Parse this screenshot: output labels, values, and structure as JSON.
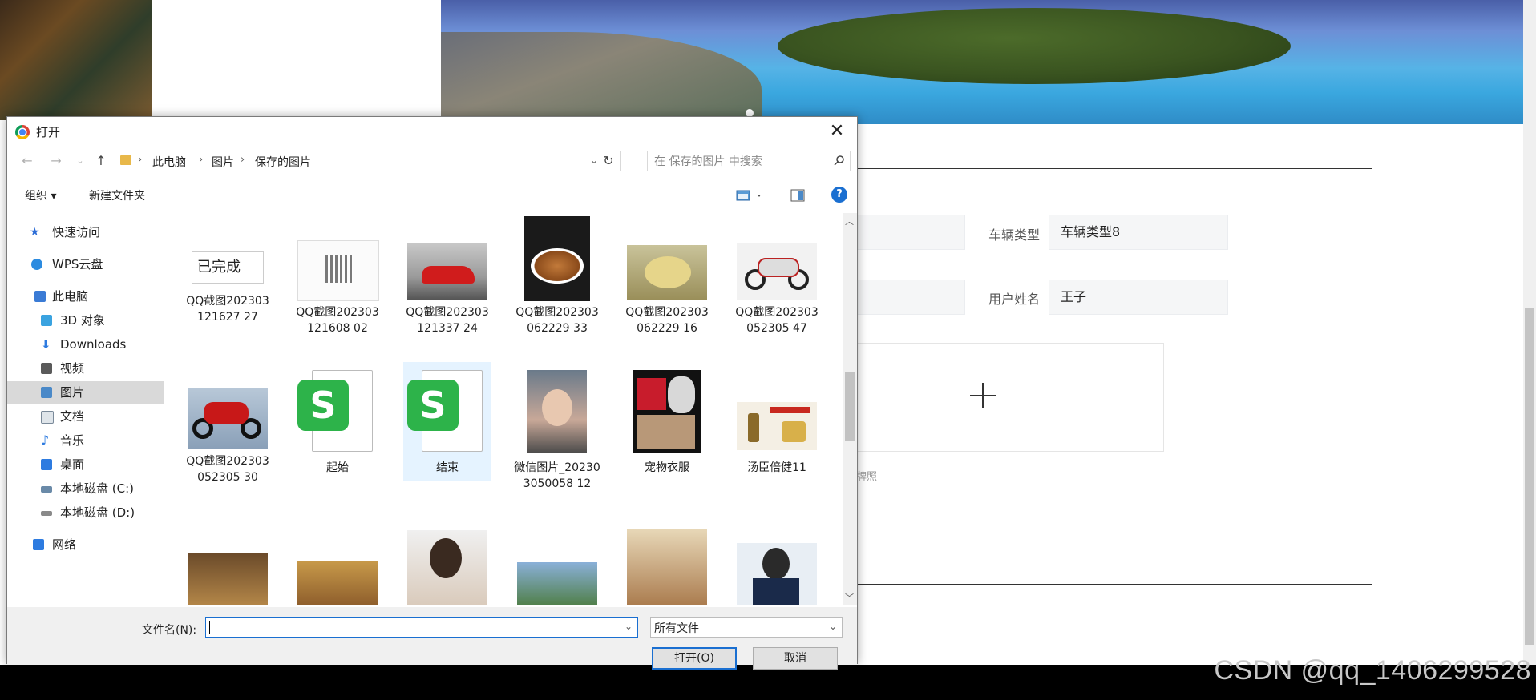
{
  "background": {
    "form": {
      "vehicle_type_label": "车辆类型",
      "vehicle_type_value": "车辆类型8",
      "user_name_label": "用户姓名",
      "user_name_value": "王子",
      "hint": "牌照"
    },
    "watermark": "CSDN @qq_1406299528"
  },
  "dialog": {
    "title": "打开",
    "close_glyph": "✕",
    "path": [
      "此电脑",
      "图片",
      "保存的图片"
    ],
    "search_placeholder": "在 保存的图片 中搜索",
    "toolbar": {
      "organize": "组织 ▾",
      "new_folder": "新建文件夹",
      "help": "?"
    },
    "nav_items": [
      {
        "label": "快速访问",
        "icon": "star-icon",
        "color": "#2b6cd6"
      },
      {
        "label": "WPS云盘",
        "icon": "cloud-icon",
        "color": "#2b8be0"
      },
      {
        "label": "此电脑",
        "icon": "computer-icon",
        "color": "#3a7bd5"
      },
      {
        "label": "3D 对象",
        "icon": "cube-icon",
        "color": "#3aa3e0"
      },
      {
        "label": "Downloads",
        "icon": "download-icon",
        "color": "#2d7be0"
      },
      {
        "label": "视频",
        "icon": "video-icon",
        "color": "#5a5a5a"
      },
      {
        "label": "图片",
        "icon": "picture-icon",
        "color": "#4a89c8"
      },
      {
        "label": "文档",
        "icon": "document-icon",
        "color": "#7a8a9a"
      },
      {
        "label": "音乐",
        "icon": "music-icon",
        "color": "#2d7be0"
      },
      {
        "label": "桌面",
        "icon": "desktop-icon",
        "color": "#2d7be0"
      },
      {
        "label": "本地磁盘 (C:)",
        "icon": "drive-c-icon",
        "color": "#6a8aa8"
      },
      {
        "label": "本地磁盘 (D:)",
        "icon": "drive-d-icon",
        "color": "#8a8a8a"
      },
      {
        "label": "网络",
        "icon": "network-icon",
        "color": "#2d7be0"
      }
    ],
    "files": [
      {
        "name": "QQ截图202303121627 27",
        "thumb_text": "已完成",
        "kind": "text"
      },
      {
        "name": "QQ截图202303121608 02",
        "kind": "qr"
      },
      {
        "name": "QQ截图202303121337 24",
        "kind": "car"
      },
      {
        "name": "QQ截图202303062229 33",
        "kind": "food-dark"
      },
      {
        "name": "QQ截图202303062229 16",
        "kind": "food-light"
      },
      {
        "name": "QQ截图202303052305 47",
        "kind": "motorbike-white"
      },
      {
        "name": "QQ截图202303052305 30",
        "kind": "motorbike-red"
      },
      {
        "name": "起始",
        "kind": "wps"
      },
      {
        "name": "结束",
        "kind": "wps"
      },
      {
        "name": "微信图片_202303050058 12",
        "kind": "portrait"
      },
      {
        "name": "宠物衣服",
        "kind": "pet"
      },
      {
        "name": "汤臣倍健11",
        "kind": "product"
      }
    ],
    "filename_label": "文件名(N):",
    "filename_value": "",
    "filetype_value": "所有文件",
    "open_button": "打开(O)",
    "cancel_button": "取消"
  }
}
